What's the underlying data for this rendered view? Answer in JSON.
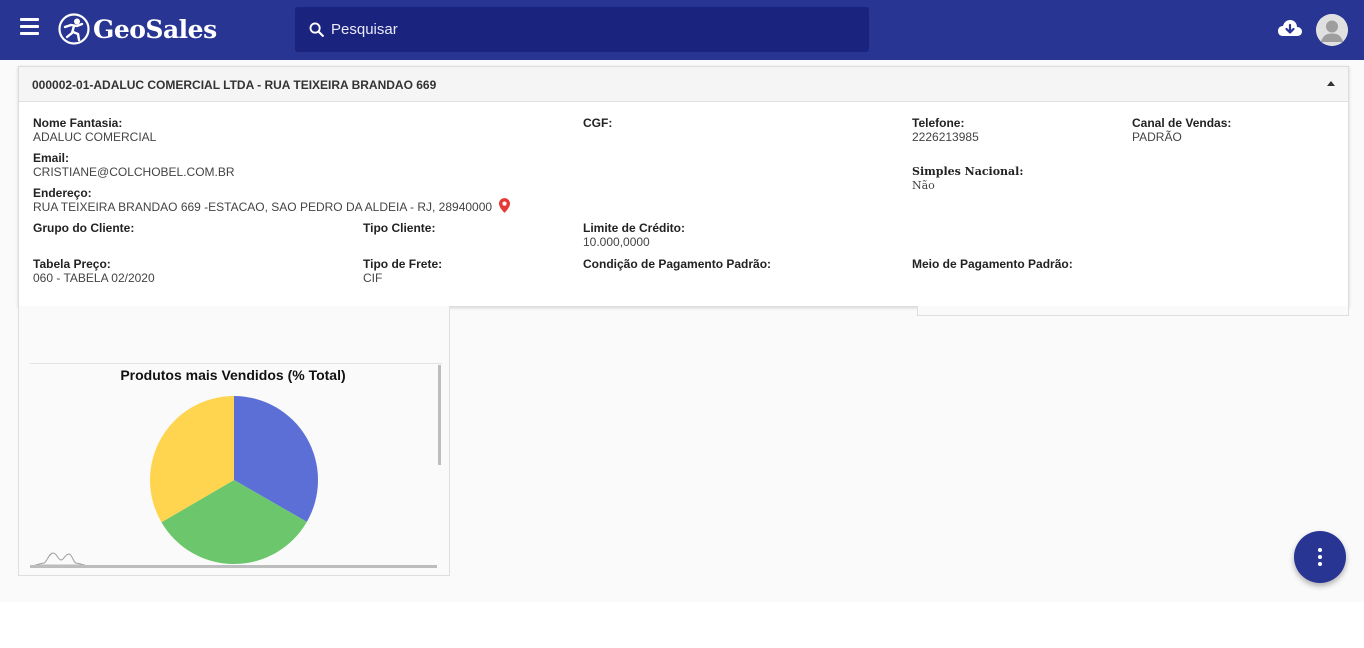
{
  "header": {
    "app_name": "GeoSales",
    "search_placeholder": "Pesquisar"
  },
  "client": {
    "title": "000002-01-ADALUC COMERCIAL LTDA - RUA TEIXEIRA BRANDAO 669",
    "nome_fantasia_label": "Nome Fantasia:",
    "nome_fantasia": "ADALUC COMERCIAL",
    "cgf_label": "CGF:",
    "cgf": "",
    "telefone_label": "Telefone:",
    "telefone": "2226213985",
    "canal_label": "Canal de Vendas:",
    "canal": "PADRÃO",
    "email_label": "Email:",
    "email": "CRISTIANE@COLCHOBEL.COM.BR",
    "simples_label": "Simples Nacional:",
    "simples": "Não",
    "endereco_label": "Endereço:",
    "endereco": "RUA TEIXEIRA BRANDAO 669 -ESTACAO, SAO PEDRO DA ALDEIA - RJ, 28940000",
    "grupo_label": "Grupo do Cliente:",
    "grupo": "",
    "tipo_cliente_label": "Tipo Cliente:",
    "tipo_cliente": "",
    "limite_label": "Limite de Crédito:",
    "limite": "10.000,0000",
    "tabela_label": "Tabela Preço:",
    "tabela": "060 - TABELA 02/2020",
    "frete_label": "Tipo de Frete:",
    "frete": "CIF",
    "condicao_label": "Condição de Pagamento Padrão:",
    "condicao": "",
    "meio_label": "Meio de Pagamento Padrão:",
    "meio": ""
  },
  "colors": {
    "primary": "#283593",
    "search_bg": "#1a237e",
    "pin": "#e53935"
  },
  "chart_data": {
    "type": "pie",
    "title": "Produtos mais Vendidos (% Total)",
    "series": [
      {
        "values": [
          33.3,
          33.3,
          33.4
        ]
      }
    ],
    "colors": [
      "#5c6fd6",
      "#6cc66c",
      "#ffd54f"
    ]
  }
}
